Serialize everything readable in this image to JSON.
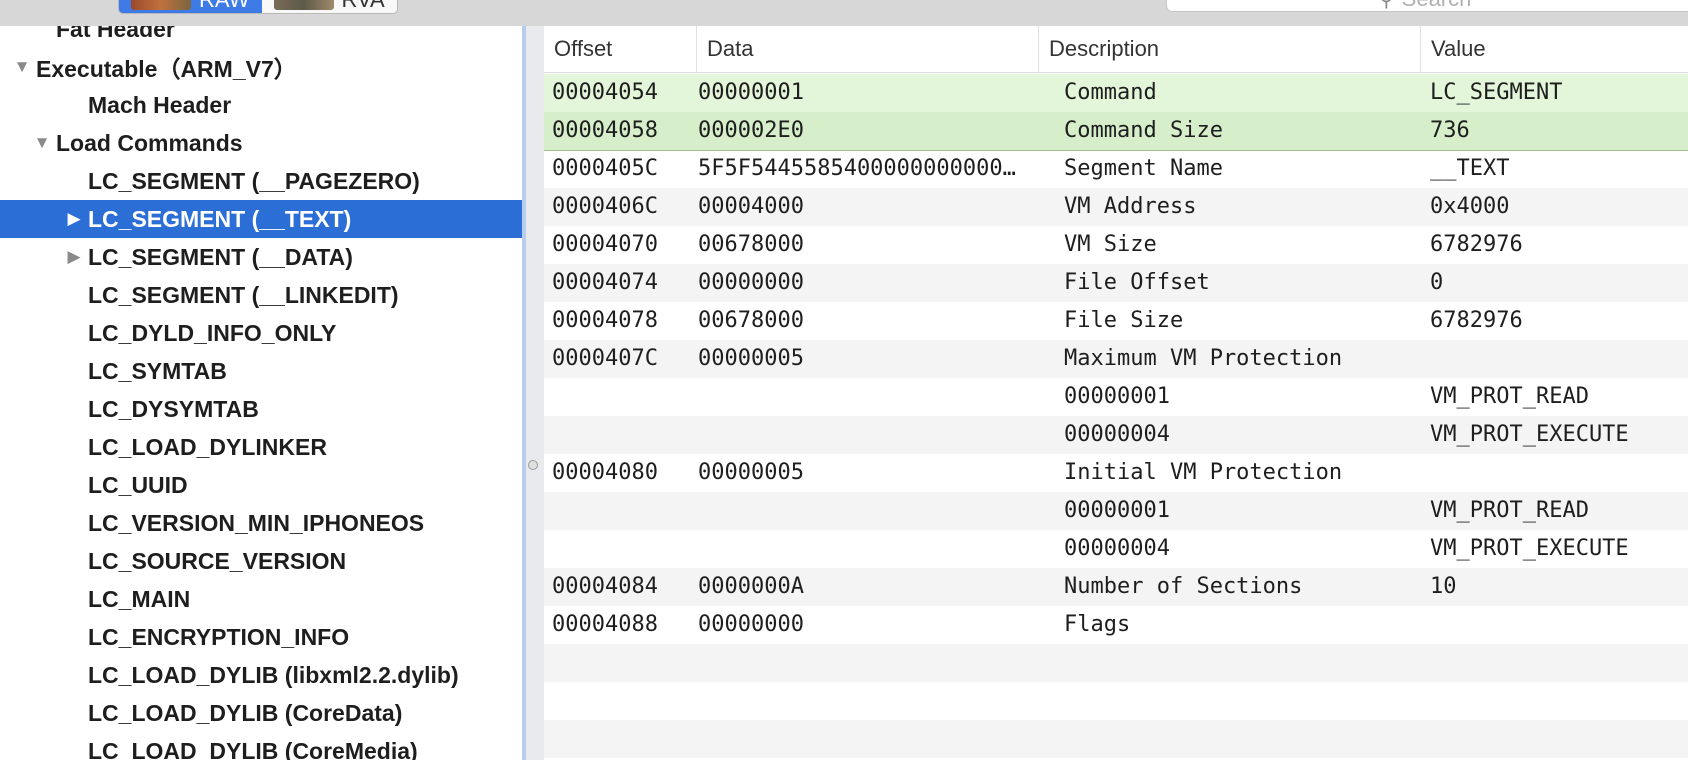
{
  "toolbar": {
    "tab_raw": "RAW",
    "tab_rva": "RVA",
    "search_placeholder": "Search"
  },
  "outline": {
    "items": [
      {
        "label": "Fat Header",
        "level": 1,
        "disclosure": "none",
        "selected": false
      },
      {
        "label": "Executable（ARM_V7）",
        "level": 0,
        "disclosure": "open",
        "selected": false
      },
      {
        "label": "Mach Header",
        "level": 2,
        "disclosure": "none",
        "selected": false
      },
      {
        "label": "Load Commands",
        "level": 1,
        "disclosure": "open",
        "selected": false
      },
      {
        "label": "LC_SEGMENT (__PAGEZERO)",
        "level": 2,
        "disclosure": "none",
        "selected": false
      },
      {
        "label": "LC_SEGMENT (__TEXT)",
        "level": 2,
        "disclosure": "closed",
        "selected": true
      },
      {
        "label": "LC_SEGMENT (__DATA)",
        "level": 2,
        "disclosure": "closed",
        "selected": false
      },
      {
        "label": "LC_SEGMENT (__LINKEDIT)",
        "level": 2,
        "disclosure": "none",
        "selected": false
      },
      {
        "label": "LC_DYLD_INFO_ONLY",
        "level": 2,
        "disclosure": "none",
        "selected": false
      },
      {
        "label": "LC_SYMTAB",
        "level": 2,
        "disclosure": "none",
        "selected": false
      },
      {
        "label": "LC_DYSYMTAB",
        "level": 2,
        "disclosure": "none",
        "selected": false
      },
      {
        "label": "LC_LOAD_DYLINKER",
        "level": 2,
        "disclosure": "none",
        "selected": false
      },
      {
        "label": "LC_UUID",
        "level": 2,
        "disclosure": "none",
        "selected": false
      },
      {
        "label": "LC_VERSION_MIN_IPHONEOS",
        "level": 2,
        "disclosure": "none",
        "selected": false
      },
      {
        "label": "LC_SOURCE_VERSION",
        "level": 2,
        "disclosure": "none",
        "selected": false
      },
      {
        "label": "LC_MAIN",
        "level": 2,
        "disclosure": "none",
        "selected": false
      },
      {
        "label": "LC_ENCRYPTION_INFO",
        "level": 2,
        "disclosure": "none",
        "selected": false
      },
      {
        "label": "LC_LOAD_DYLIB (libxml2.2.dylib)",
        "level": 2,
        "disclosure": "none",
        "selected": false
      },
      {
        "label": "LC_LOAD_DYLIB (CoreData)",
        "level": 2,
        "disclosure": "none",
        "selected": false
      },
      {
        "label": "LC_LOAD_DYLIB (CoreMedia)",
        "level": 2,
        "disclosure": "none",
        "selected": false
      }
    ]
  },
  "table": {
    "columns": [
      "Offset",
      "Data",
      "Description",
      "Value"
    ],
    "rows": [
      {
        "offset": "00004054",
        "data": "00000001",
        "description": "Command",
        "value": "LC_SEGMENT",
        "highlight": true
      },
      {
        "offset": "00004058",
        "data": "000002E0",
        "description": "Command Size",
        "value": "736",
        "highlight": true
      },
      {
        "offset": "0000405C",
        "data": "5F5F5445585400000000000…",
        "description": "Segment Name",
        "value": "__TEXT",
        "highlight": false
      },
      {
        "offset": "0000406C",
        "data": "00004000",
        "description": "VM Address",
        "value": "0x4000",
        "highlight": false
      },
      {
        "offset": "00004070",
        "data": "00678000",
        "description": "VM Size",
        "value": "6782976",
        "highlight": false
      },
      {
        "offset": "00004074",
        "data": "00000000",
        "description": "File Offset",
        "value": "0",
        "highlight": false
      },
      {
        "offset": "00004078",
        "data": "00678000",
        "description": "File Size",
        "value": "6782976",
        "highlight": false
      },
      {
        "offset": "0000407C",
        "data": "00000005",
        "description": "Maximum VM Protection",
        "value": "",
        "highlight": false
      },
      {
        "offset": "",
        "data": "",
        "description": "00000001",
        "value": "VM_PROT_READ",
        "highlight": false
      },
      {
        "offset": "",
        "data": "",
        "description": "00000004",
        "value": "VM_PROT_EXECUTE",
        "highlight": false
      },
      {
        "offset": "00004080",
        "data": "00000005",
        "description": "Initial VM Protection",
        "value": "",
        "highlight": false
      },
      {
        "offset": "",
        "data": "",
        "description": "00000001",
        "value": "VM_PROT_READ",
        "highlight": false
      },
      {
        "offset": "",
        "data": "",
        "description": "00000004",
        "value": "VM_PROT_EXECUTE",
        "highlight": false
      },
      {
        "offset": "00004084",
        "data": "0000000A",
        "description": "Number of Sections",
        "value": "10",
        "highlight": false
      },
      {
        "offset": "00004088",
        "data": "00000000",
        "description": "Flags",
        "value": "",
        "highlight": false
      }
    ]
  }
}
